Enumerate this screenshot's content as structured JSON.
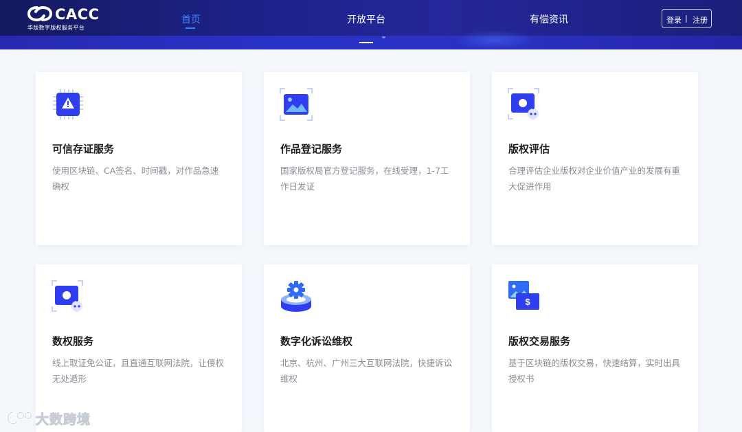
{
  "header": {
    "logo_text": "CACC",
    "logo_subtitle": "华版数字版权服务平台",
    "nav": {
      "home": "首页",
      "open_platform": "开放平台",
      "news": "有偿资讯"
    },
    "auth": {
      "login": "登录",
      "separator": "|",
      "register": "注册"
    }
  },
  "cards": [
    {
      "title": "可信存证服务",
      "desc": "使用区块链、CA签名、时间戳，对作品急速确权",
      "icon": "chip-alert-icon"
    },
    {
      "title": "作品登记服务",
      "desc": "国家版权局官方登记服务，在线受理，1-7工作日发证",
      "icon": "image-frame-icon"
    },
    {
      "title": "版权评估",
      "desc": "合理评估企业版权对企业价值产业的发展有重大促进作用",
      "icon": "monitor-robot-icon"
    },
    {
      "title": "数权服务",
      "desc": "线上取证免公证，且直通互联网法院，让侵权无处遁形",
      "icon": "monitor-robot-icon"
    },
    {
      "title": "数字化诉讼维权",
      "desc": "北京、杭州、广州三大互联网法院，快捷诉讼维权",
      "icon": "gear-platform-icon"
    },
    {
      "title": "版权交易服务",
      "desc": "基于区块链的版权交易，快速结算，实时出具授权书",
      "icon": "image-dollar-icon"
    }
  ],
  "watermark": {
    "text": "大数跨境"
  },
  "colors": {
    "header_dark": "#1d228a",
    "accent_blue": "#3d86ff",
    "icon_blue": "#2f3ff0",
    "background": "#f4f7fc",
    "card_title": "#1e1e1e",
    "card_desc": "#8a8d96"
  }
}
